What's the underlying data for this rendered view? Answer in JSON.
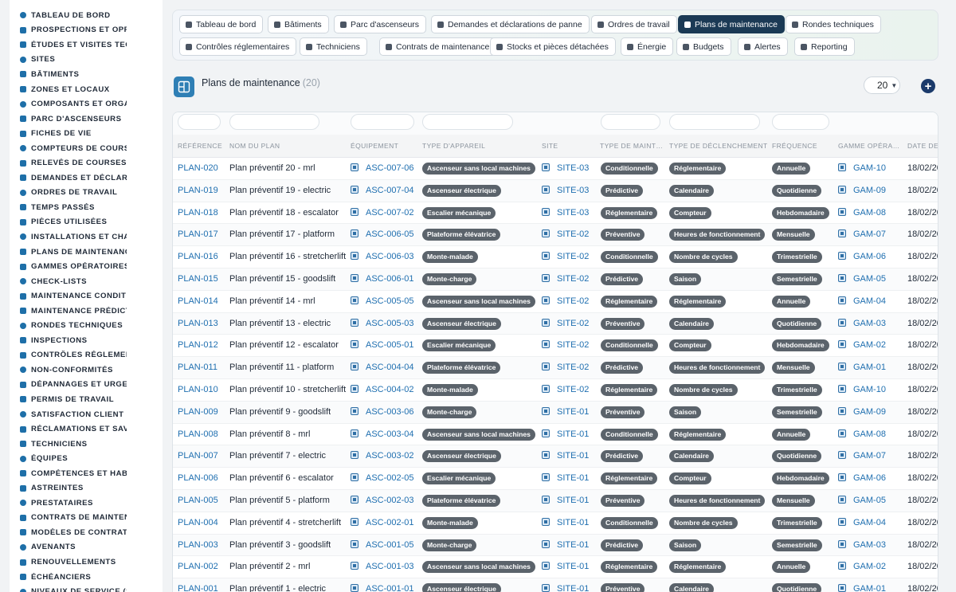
{
  "sidebar": {
    "items": [
      {
        "label": "TABLEAU DE BORD",
        "icon": "dashboard-icon"
      },
      {
        "label": "PROSPECTIONS ET OPPORTUNITÉS",
        "icon": "target-icon"
      },
      {
        "label": "ÉTUDES ET VISITES TECHNIQUES",
        "icon": "ruler-icon"
      },
      {
        "label": "SITES",
        "icon": "map-pin-icon"
      },
      {
        "label": "BÂTIMENTS",
        "icon": "building-icon"
      },
      {
        "label": "ZONES ET LOCAUX",
        "icon": "zones-icon"
      },
      {
        "label": "COMPOSANTS ET ORGANES",
        "icon": "sitemap-icon"
      },
      {
        "label": "PARC D'ASCENSEURS",
        "icon": "cogs-icon"
      },
      {
        "label": "FICHES DE VIE",
        "icon": "history-icon"
      },
      {
        "label": "COMPTEURS DE COURSES",
        "icon": "gauge-icon"
      },
      {
        "label": "RELEVÉS DE COURSES",
        "icon": "readings-icon"
      },
      {
        "label": "DEMANDES ET DÉCLARATIONS",
        "icon": "question-icon"
      },
      {
        "label": "ORDRES DE TRAVAIL",
        "icon": "clipboard-icon"
      },
      {
        "label": "TEMPS PASSÉS",
        "icon": "clock-icon"
      },
      {
        "label": "PIÈCES UTILISÉES",
        "icon": "list-icon"
      },
      {
        "label": "INSTALLATIONS ET CHANTIERS",
        "icon": "hammer-icon"
      },
      {
        "label": "PLANS DE MAINTENANCE",
        "icon": "calendar-icon"
      },
      {
        "label": "GAMMES OPÉRATOIRES",
        "icon": "tasks-icon"
      },
      {
        "label": "CHECK-LISTS",
        "icon": "checklist-icon"
      },
      {
        "label": "MAINTENANCE CONDITIONNELLE",
        "icon": "thermometer-icon"
      },
      {
        "label": "MAINTENANCE PRÉDICTIVE",
        "icon": "chart-icon"
      },
      {
        "label": "RONDES TECHNIQUES",
        "icon": "route-icon"
      },
      {
        "label": "INSPECTIONS",
        "icon": "search-icon"
      },
      {
        "label": "CONTRÔLES RÉGLEMENTAIRES",
        "icon": "clipboard-check-icon"
      },
      {
        "label": "NON-CONFORMITÉS",
        "icon": "ban-icon"
      },
      {
        "label": "DÉPANNAGES ET URGENCES",
        "icon": "warning-icon"
      },
      {
        "label": "PERMIS DE TRAVAIL",
        "icon": "file-icon"
      },
      {
        "label": "SATISFACTION CLIENT",
        "icon": "smile-icon"
      },
      {
        "label": "RÉCLAMATIONS ET SAV",
        "icon": "comments-icon"
      },
      {
        "label": "TECHNICIENS",
        "icon": "hard-hat-icon"
      },
      {
        "label": "ÉQUIPES",
        "icon": "users-icon"
      },
      {
        "label": "COMPÉTENCES ET HABILITATIONS",
        "icon": "award-icon"
      },
      {
        "label": "ASTREINTES",
        "icon": "phone-icon"
      },
      {
        "label": "PRESTATAIRES",
        "icon": "handshake-icon"
      },
      {
        "label": "CONTRATS DE MAINTENANCE",
        "icon": "contract-icon"
      },
      {
        "label": "MODÈLES DE CONTRATS",
        "icon": "copy-icon"
      },
      {
        "label": "AVENANTS",
        "icon": "edit-icon"
      },
      {
        "label": "RENOUVELLEMENTS",
        "icon": "sync-icon"
      },
      {
        "label": "ÉCHÉANCIERS",
        "icon": "schedule-icon"
      },
      {
        "label": "NIVEAUX DE SERVICE (SLA)",
        "icon": "sla-icon"
      }
    ]
  },
  "nav": {
    "buttons": [
      {
        "label": "Tableau de bord",
        "icon": "dashboard-icon",
        "active": false
      },
      {
        "label": "Bâtiments",
        "icon": "building-icon",
        "active": false
      },
      {
        "label": "Parc d'ascenseurs",
        "icon": "cogs-icon",
        "active": false
      },
      {
        "label": "Demandes et déclarations de panne",
        "icon": "question-icon",
        "active": false
      },
      {
        "label": "Ordres de travail",
        "icon": "clipboard-icon",
        "active": false
      },
      {
        "label": "Plans de maintenance",
        "icon": "calendar-icon",
        "active": true
      },
      {
        "label": "Rondes techniques",
        "icon": "route-icon",
        "active": false
      },
      {
        "label": "Contrôles réglementaires",
        "icon": "clipboard-check-icon",
        "active": false
      },
      {
        "label": "Techniciens",
        "icon": "hard-hat-icon",
        "active": false
      },
      {
        "label": "Contrats de maintenance",
        "icon": "contract-icon",
        "active": false
      },
      {
        "label": "Stocks et pièces détachées",
        "icon": "boxes-icon",
        "active": false
      },
      {
        "label": "Énergie",
        "icon": "bolt-icon",
        "active": false
      },
      {
        "label": "Budgets",
        "icon": "money-icon",
        "active": false
      },
      {
        "label": "Alertes",
        "icon": "bell-icon",
        "active": false
      },
      {
        "label": "Reporting",
        "icon": "pie-icon",
        "active": false
      }
    ]
  },
  "page": {
    "title": "Plans de maintenance",
    "count": "(20)",
    "per_page": "20",
    "add_label": "+"
  },
  "colors": {
    "active_nav": "#1b3a55",
    "link": "#1f6fb0",
    "badge": "#5b636b",
    "add_button": "#1b3a6b"
  },
  "table": {
    "columns": [
      "RÉFÉRENCE",
      "NOM DU PLAN",
      "ÉQUIPEMENT",
      "TYPE D'APPAREIL",
      "SITE",
      "TYPE DE MAINT…",
      "TYPE DE DÉCLENCHEMENT",
      "FRÉQUENCE",
      "GAMME OPÉRA…",
      "DATE DE"
    ],
    "rows": [
      {
        "ref": "PLAN-020",
        "name": "Plan préventif 20 - mrl",
        "equip": "ASC-007-06",
        "type": "Ascenseur sans local machines",
        "site": "SITE-03",
        "maint": "Conditionnelle",
        "trigger": "Réglementaire",
        "freq": "Annuelle",
        "gamme": "GAM-10",
        "date": "18/02/20"
      },
      {
        "ref": "PLAN-019",
        "name": "Plan préventif 19 - electric",
        "equip": "ASC-007-04",
        "type": "Ascenseur électrique",
        "site": "SITE-03",
        "maint": "Prédictive",
        "trigger": "Calendaire",
        "freq": "Quotidienne",
        "gamme": "GAM-09",
        "date": "18/02/20"
      },
      {
        "ref": "PLAN-018",
        "name": "Plan préventif 18 - escalator",
        "equip": "ASC-007-02",
        "type": "Escalier mécanique",
        "site": "SITE-03",
        "maint": "Réglementaire",
        "trigger": "Compteur",
        "freq": "Hebdomadaire",
        "gamme": "GAM-08",
        "date": "18/02/20"
      },
      {
        "ref": "PLAN-017",
        "name": "Plan préventif 17 - platform",
        "equip": "ASC-006-05",
        "type": "Plateforme élévatrice",
        "site": "SITE-02",
        "maint": "Préventive",
        "trigger": "Heures de fonctionnement",
        "freq": "Mensuelle",
        "gamme": "GAM-07",
        "date": "18/02/20"
      },
      {
        "ref": "PLAN-016",
        "name": "Plan préventif 16 - stretcherlift",
        "equip": "ASC-006-03",
        "type": "Monte-malade",
        "site": "SITE-02",
        "maint": "Conditionnelle",
        "trigger": "Nombre de cycles",
        "freq": "Trimestrielle",
        "gamme": "GAM-06",
        "date": "18/02/20"
      },
      {
        "ref": "PLAN-015",
        "name": "Plan préventif 15 - goodslift",
        "equip": "ASC-006-01",
        "type": "Monte-charge",
        "site": "SITE-02",
        "maint": "Prédictive",
        "trigger": "Saison",
        "freq": "Semestrielle",
        "gamme": "GAM-05",
        "date": "18/02/20"
      },
      {
        "ref": "PLAN-014",
        "name": "Plan préventif 14 - mrl",
        "equip": "ASC-005-05",
        "type": "Ascenseur sans local machines",
        "site": "SITE-02",
        "maint": "Réglementaire",
        "trigger": "Réglementaire",
        "freq": "Annuelle",
        "gamme": "GAM-04",
        "date": "18/02/20"
      },
      {
        "ref": "PLAN-013",
        "name": "Plan préventif 13 - electric",
        "equip": "ASC-005-03",
        "type": "Ascenseur électrique",
        "site": "SITE-02",
        "maint": "Préventive",
        "trigger": "Calendaire",
        "freq": "Quotidienne",
        "gamme": "GAM-03",
        "date": "18/02/20"
      },
      {
        "ref": "PLAN-012",
        "name": "Plan préventif 12 - escalator",
        "equip": "ASC-005-01",
        "type": "Escalier mécanique",
        "site": "SITE-02",
        "maint": "Conditionnelle",
        "trigger": "Compteur",
        "freq": "Hebdomadaire",
        "gamme": "GAM-02",
        "date": "18/02/20"
      },
      {
        "ref": "PLAN-011",
        "name": "Plan préventif 11 - platform",
        "equip": "ASC-004-04",
        "type": "Plateforme élévatrice",
        "site": "SITE-02",
        "maint": "Prédictive",
        "trigger": "Heures de fonctionnement",
        "freq": "Mensuelle",
        "gamme": "GAM-01",
        "date": "18/02/20"
      },
      {
        "ref": "PLAN-010",
        "name": "Plan préventif 10 - stretcherlift",
        "equip": "ASC-004-02",
        "type": "Monte-malade",
        "site": "SITE-02",
        "maint": "Réglementaire",
        "trigger": "Nombre de cycles",
        "freq": "Trimestrielle",
        "gamme": "GAM-10",
        "date": "18/02/20"
      },
      {
        "ref": "PLAN-009",
        "name": "Plan préventif 9 - goodslift",
        "equip": "ASC-003-06",
        "type": "Monte-charge",
        "site": "SITE-01",
        "maint": "Préventive",
        "trigger": "Saison",
        "freq": "Semestrielle",
        "gamme": "GAM-09",
        "date": "18/02/20"
      },
      {
        "ref": "PLAN-008",
        "name": "Plan préventif 8 - mrl",
        "equip": "ASC-003-04",
        "type": "Ascenseur sans local machines",
        "site": "SITE-01",
        "maint": "Conditionnelle",
        "trigger": "Réglementaire",
        "freq": "Annuelle",
        "gamme": "GAM-08",
        "date": "18/02/20"
      },
      {
        "ref": "PLAN-007",
        "name": "Plan préventif 7 - electric",
        "equip": "ASC-003-02",
        "type": "Ascenseur électrique",
        "site": "SITE-01",
        "maint": "Prédictive",
        "trigger": "Calendaire",
        "freq": "Quotidienne",
        "gamme": "GAM-07",
        "date": "18/02/20"
      },
      {
        "ref": "PLAN-006",
        "name": "Plan préventif 6 - escalator",
        "equip": "ASC-002-05",
        "type": "Escalier mécanique",
        "site": "SITE-01",
        "maint": "Réglementaire",
        "trigger": "Compteur",
        "freq": "Hebdomadaire",
        "gamme": "GAM-06",
        "date": "18/02/20"
      },
      {
        "ref": "PLAN-005",
        "name": "Plan préventif 5 - platform",
        "equip": "ASC-002-03",
        "type": "Plateforme élévatrice",
        "site": "SITE-01",
        "maint": "Préventive",
        "trigger": "Heures de fonctionnement",
        "freq": "Mensuelle",
        "gamme": "GAM-05",
        "date": "18/02/20"
      },
      {
        "ref": "PLAN-004",
        "name": "Plan préventif 4 - stretcherlift",
        "equip": "ASC-002-01",
        "type": "Monte-malade",
        "site": "SITE-01",
        "maint": "Conditionnelle",
        "trigger": "Nombre de cycles",
        "freq": "Trimestrielle",
        "gamme": "GAM-04",
        "date": "18/02/20"
      },
      {
        "ref": "PLAN-003",
        "name": "Plan préventif 3 - goodslift",
        "equip": "ASC-001-05",
        "type": "Monte-charge",
        "site": "SITE-01",
        "maint": "Prédictive",
        "trigger": "Saison",
        "freq": "Semestrielle",
        "gamme": "GAM-03",
        "date": "18/02/20"
      },
      {
        "ref": "PLAN-002",
        "name": "Plan préventif 2 - mrl",
        "equip": "ASC-001-03",
        "type": "Ascenseur sans local machines",
        "site": "SITE-01",
        "maint": "Réglementaire",
        "trigger": "Réglementaire",
        "freq": "Annuelle",
        "gamme": "GAM-02",
        "date": "18/02/20"
      },
      {
        "ref": "PLAN-001",
        "name": "Plan préventif 1 - electric",
        "equip": "ASC-001-01",
        "type": "Ascenseur électrique",
        "site": "SITE-01",
        "maint": "Préventive",
        "trigger": "Calendaire",
        "freq": "Quotidienne",
        "gamme": "GAM-01",
        "date": "18/02/20"
      }
    ]
  }
}
